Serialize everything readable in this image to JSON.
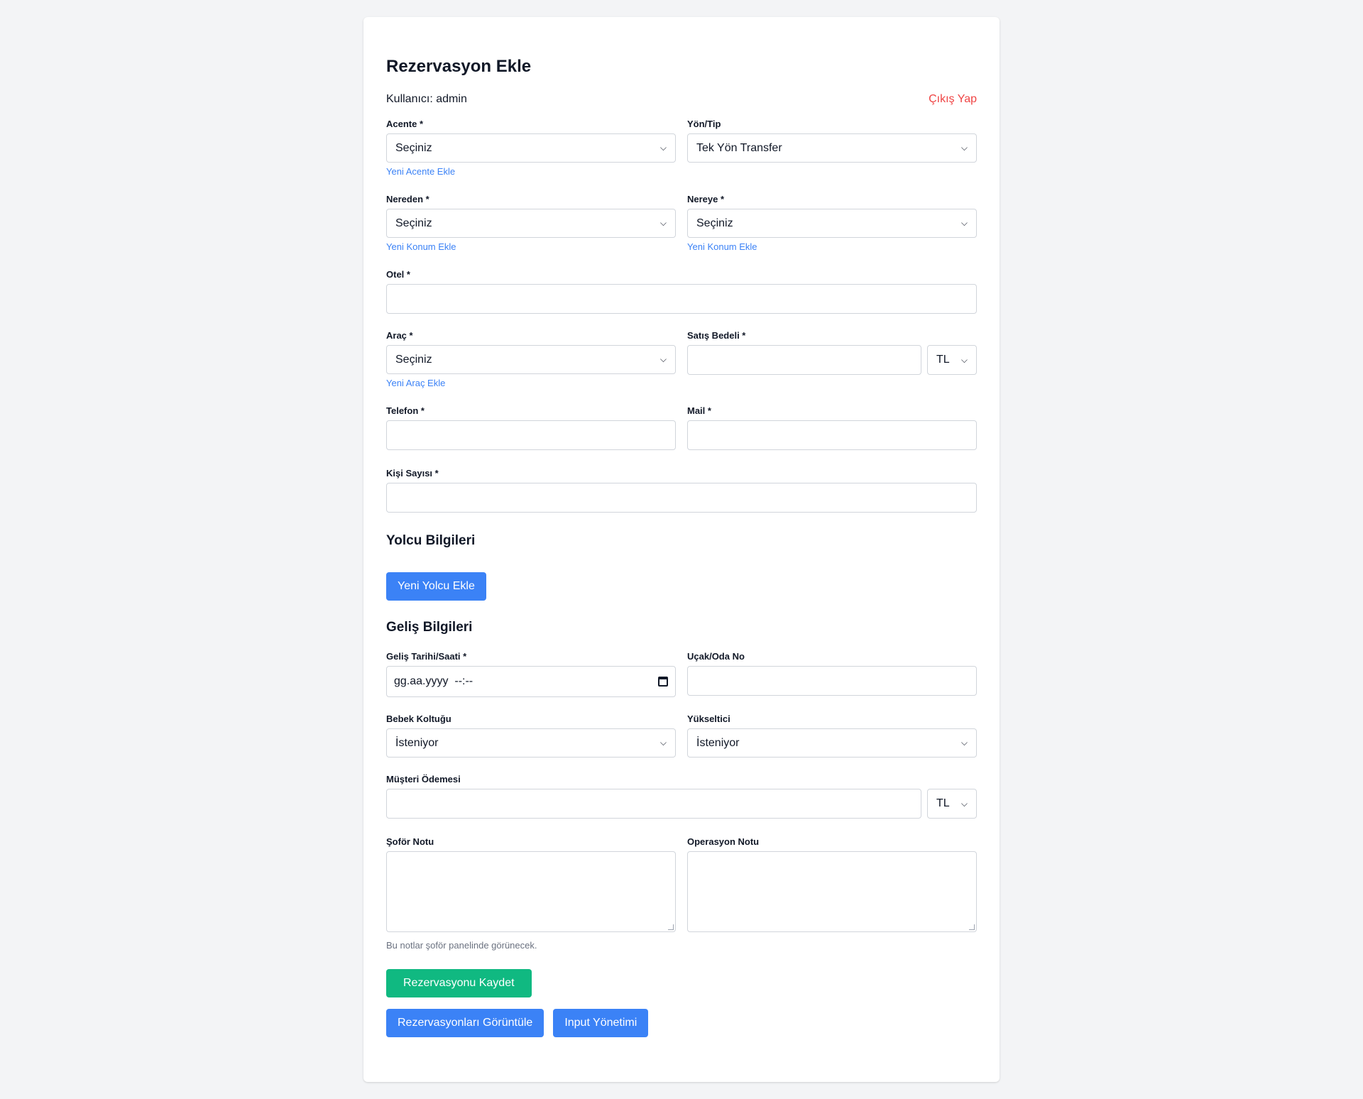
{
  "page": {
    "title": "Rezervasyon Ekle",
    "user_label": "Kullanıcı: admin",
    "logout": "Çıkış Yap"
  },
  "form": {
    "acente": {
      "label": "Acente *",
      "value": "Seçiniz",
      "helper": "Yeni Acente Ekle"
    },
    "yon_tip": {
      "label": "Yön/Tip",
      "value": "Tek Yön Transfer"
    },
    "nereden": {
      "label": "Nereden *",
      "value": "Seçiniz",
      "helper": "Yeni Konum Ekle"
    },
    "nereye": {
      "label": "Nereye *",
      "value": "Seçiniz",
      "helper": "Yeni Konum Ekle"
    },
    "otel": {
      "label": "Otel *",
      "value": ""
    },
    "arac": {
      "label": "Araç *",
      "value": "Seçiniz",
      "helper": "Yeni Araç Ekle"
    },
    "satis_bedeli": {
      "label": "Satış Bedeli *",
      "value": "",
      "currency": "TL"
    },
    "telefon": {
      "label": "Telefon *",
      "value": ""
    },
    "mail": {
      "label": "Mail *",
      "value": ""
    },
    "kisi_sayisi": {
      "label": "Kişi Sayısı *",
      "value": ""
    }
  },
  "yolcu": {
    "heading": "Yolcu Bilgileri",
    "add_button": "Yeni Yolcu Ekle"
  },
  "gelis": {
    "heading": "Geliş Bilgileri",
    "tarih": {
      "label": "Geliş Tarihi/Saati *",
      "placeholder": "gg.aa.yyyy  --:--"
    },
    "ucak_oda": {
      "label": "Uçak/Oda No",
      "value": ""
    },
    "bebek_koltugu": {
      "label": "Bebek Koltuğu",
      "value": "İsteniyor"
    },
    "yukseltici": {
      "label": "Yükseltici",
      "value": "İsteniyor"
    },
    "musteri_odemesi": {
      "label": "Müşteri Ödemesi",
      "value": "",
      "currency": "TL"
    },
    "sofor_notu": {
      "label": "Şoför Notu"
    },
    "operasyon_notu": {
      "label": "Operasyon Notu"
    },
    "note_hint": "Bu notlar şoför panelinde görünecek."
  },
  "actions": {
    "save": "Rezervasyonu Kaydet",
    "view": "Rezervasyonları Görüntüle",
    "input_mgmt": "Input Yönetimi"
  },
  "colors": {
    "primary": "#3b82f6",
    "success": "#10b981",
    "danger": "#ef4444",
    "background": "#f3f4f6"
  }
}
